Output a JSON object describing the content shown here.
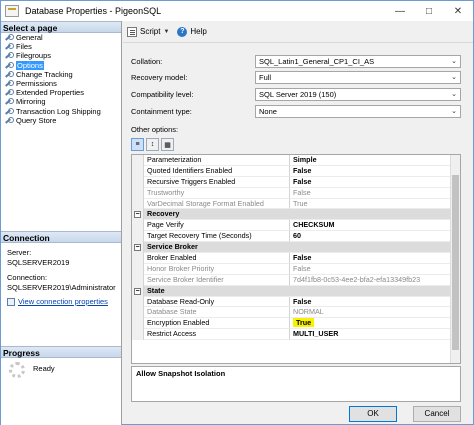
{
  "window": {
    "title": "Database Properties - PigeonSQL"
  },
  "select_page": {
    "header": "Select a page",
    "items": [
      {
        "label": "General",
        "selected": false
      },
      {
        "label": "Files",
        "selected": false
      },
      {
        "label": "Filegroups",
        "selected": false
      },
      {
        "label": "Options",
        "selected": true
      },
      {
        "label": "Change Tracking",
        "selected": false
      },
      {
        "label": "Permissions",
        "selected": false
      },
      {
        "label": "Extended Properties",
        "selected": false
      },
      {
        "label": "Mirroring",
        "selected": false
      },
      {
        "label": "Transaction Log Shipping",
        "selected": false
      },
      {
        "label": "Query Store",
        "selected": false
      }
    ]
  },
  "connection": {
    "header": "Connection",
    "server_label": "Server:",
    "server_value": "SQLSERVER2019",
    "conn_label": "Connection:",
    "conn_value": "SQLSERVER2019\\Administrator",
    "view_link": "View connection properties"
  },
  "progress": {
    "header": "Progress",
    "status": "Ready"
  },
  "toolbar": {
    "script_label": "Script",
    "help_label": "Help"
  },
  "fields": {
    "collation": {
      "label": "Collation:",
      "value": "SQL_Latin1_General_CP1_CI_AS"
    },
    "recovery_model": {
      "label": "Recovery model:",
      "value": "Full"
    },
    "compat_level": {
      "label": "Compatibility level:",
      "value": "SQL Server 2019 (150)"
    },
    "containment": {
      "label": "Containment type:",
      "value": "None"
    }
  },
  "other_options_label": "Other options:",
  "grid_rows": [
    {
      "kind": "prop",
      "name": "Parameterization",
      "value": "Simple",
      "bold": true,
      "dim": false
    },
    {
      "kind": "prop",
      "name": "Quoted Identifiers Enabled",
      "value": "False",
      "bold": true,
      "dim": false
    },
    {
      "kind": "prop",
      "name": "Recursive Triggers Enabled",
      "value": "False",
      "bold": true,
      "dim": false
    },
    {
      "kind": "prop",
      "name": "Trustworthy",
      "value": "False",
      "bold": false,
      "dim": true
    },
    {
      "kind": "prop",
      "name": "VarDecimal Storage Format Enabled",
      "value": "True",
      "bold": false,
      "dim": true
    },
    {
      "kind": "cat",
      "name": "Recovery"
    },
    {
      "kind": "prop",
      "name": "Page Verify",
      "value": "CHECKSUM",
      "bold": true,
      "dim": false
    },
    {
      "kind": "prop",
      "name": "Target Recovery Time (Seconds)",
      "value": "60",
      "bold": true,
      "dim": false
    },
    {
      "kind": "cat",
      "name": "Service Broker"
    },
    {
      "kind": "prop",
      "name": "Broker Enabled",
      "value": "False",
      "bold": true,
      "dim": false
    },
    {
      "kind": "prop",
      "name": "Honor Broker Priority",
      "value": "False",
      "bold": false,
      "dim": true
    },
    {
      "kind": "prop",
      "name": "Service Broker Identifier",
      "value": "7d4f1fb8-0c53-4ee2-bfa2-efa13349fb23",
      "bold": false,
      "dim": true
    },
    {
      "kind": "cat",
      "name": "State"
    },
    {
      "kind": "prop",
      "name": "Database Read-Only",
      "value": "False",
      "bold": true,
      "dim": false
    },
    {
      "kind": "prop",
      "name": "Database State",
      "value": "NORMAL",
      "bold": false,
      "dim": true
    },
    {
      "kind": "prop",
      "name": "Encryption Enabled",
      "value": "True",
      "bold": true,
      "dim": false,
      "highlight": true
    },
    {
      "kind": "prop",
      "name": "Restrict Access",
      "value": "MULTI_USER",
      "bold": true,
      "dim": false
    }
  ],
  "description": "Allow Snapshot Isolation",
  "buttons": {
    "ok": "OK",
    "cancel": "Cancel"
  },
  "colors": {
    "selection": "#3399ff",
    "highlight": "#f6f200",
    "link": "#0645ad"
  }
}
